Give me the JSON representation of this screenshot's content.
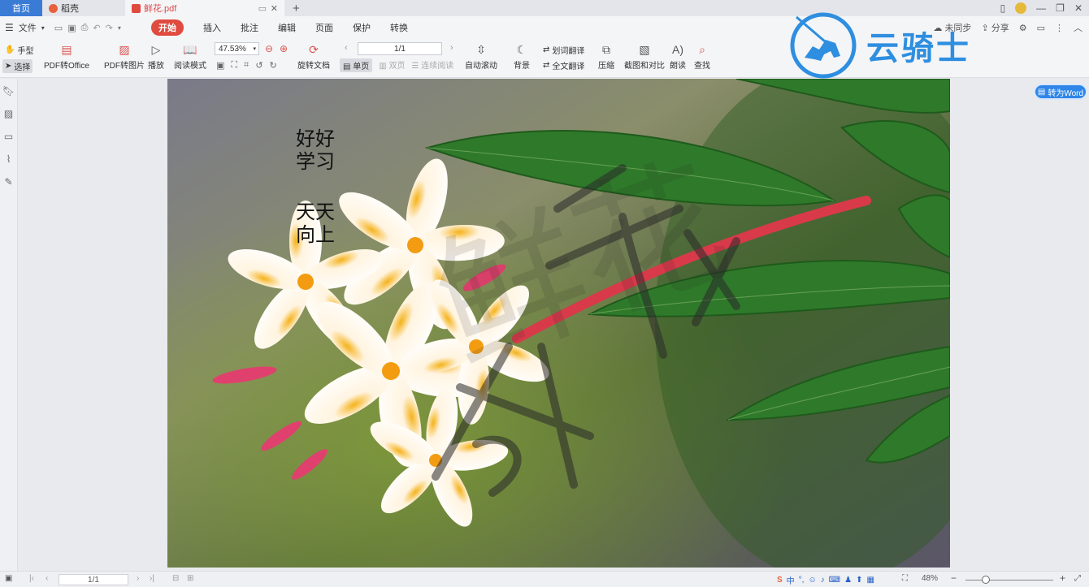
{
  "tabs": {
    "home": "首页",
    "app": "稻壳",
    "doc": "鲜花.pdf"
  },
  "menu": {
    "file": "文件",
    "tabs": [
      "开始",
      "插入",
      "批注",
      "编辑",
      "页面",
      "保护",
      "转换"
    ],
    "active_tab": "开始",
    "sync": "未同步",
    "share": "分享"
  },
  "toolbar": {
    "hand": "手型",
    "select": "选择",
    "pdf_to_office": "PDF转Office",
    "pdf_to_image": "PDF转图片",
    "play": "播放",
    "read_mode": "阅读模式",
    "zoom": "47.53%",
    "rotate": "旋转文档",
    "page": "1/1",
    "single_page": "单页",
    "double_page": "双页",
    "continuous": "连续阅读",
    "auto_scroll": "自动滚动",
    "background": "背景",
    "word_translate": "划词翻译",
    "full_translate": "全文翻译",
    "compress": "压缩",
    "screenshot_compare": "截图和对比",
    "read_aloud": "朗读",
    "find": "查找"
  },
  "logo": {
    "text": "云骑士"
  },
  "convert_to_word": "转为Word",
  "page_content": {
    "line1": "好好",
    "line2": "学习",
    "line3": "天天",
    "line4": "向上",
    "watermark": "鲜花"
  },
  "statusbar": {
    "page": "1/1",
    "zoom": "48%"
  }
}
